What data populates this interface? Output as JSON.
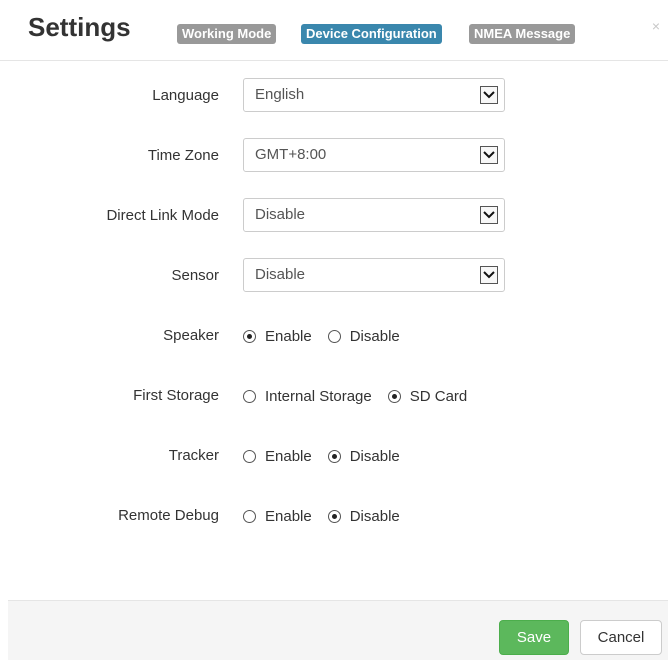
{
  "header": {
    "title": "Settings",
    "tabs": [
      {
        "label": "Working Mode",
        "active": false
      },
      {
        "label": "Device Configuration",
        "active": true
      },
      {
        "label": "NMEA Message",
        "active": false
      }
    ],
    "close_label": "×"
  },
  "form": {
    "language": {
      "label": "Language",
      "value": "English"
    },
    "time_zone": {
      "label": "Time Zone",
      "value": "GMT+8:00"
    },
    "direct_link_mode": {
      "label": "Direct Link Mode",
      "value": "Disable"
    },
    "sensor": {
      "label": "Sensor",
      "value": "Disable"
    },
    "speaker": {
      "label": "Speaker",
      "options": [
        "Enable",
        "Disable"
      ],
      "selected": "Enable"
    },
    "first_storage": {
      "label": "First Storage",
      "options": [
        "Internal Storage",
        "SD Card"
      ],
      "selected": "SD Card"
    },
    "tracker": {
      "label": "Tracker",
      "options": [
        "Enable",
        "Disable"
      ],
      "selected": "Disable"
    },
    "remote_debug": {
      "label": "Remote Debug",
      "options": [
        "Enable",
        "Disable"
      ],
      "selected": "Disable"
    }
  },
  "footer": {
    "save_label": "Save",
    "cancel_label": "Cancel"
  },
  "colors": {
    "tab_active": "#3a87ad",
    "tab_inactive": "#999999",
    "save_button": "#5cb85c"
  }
}
